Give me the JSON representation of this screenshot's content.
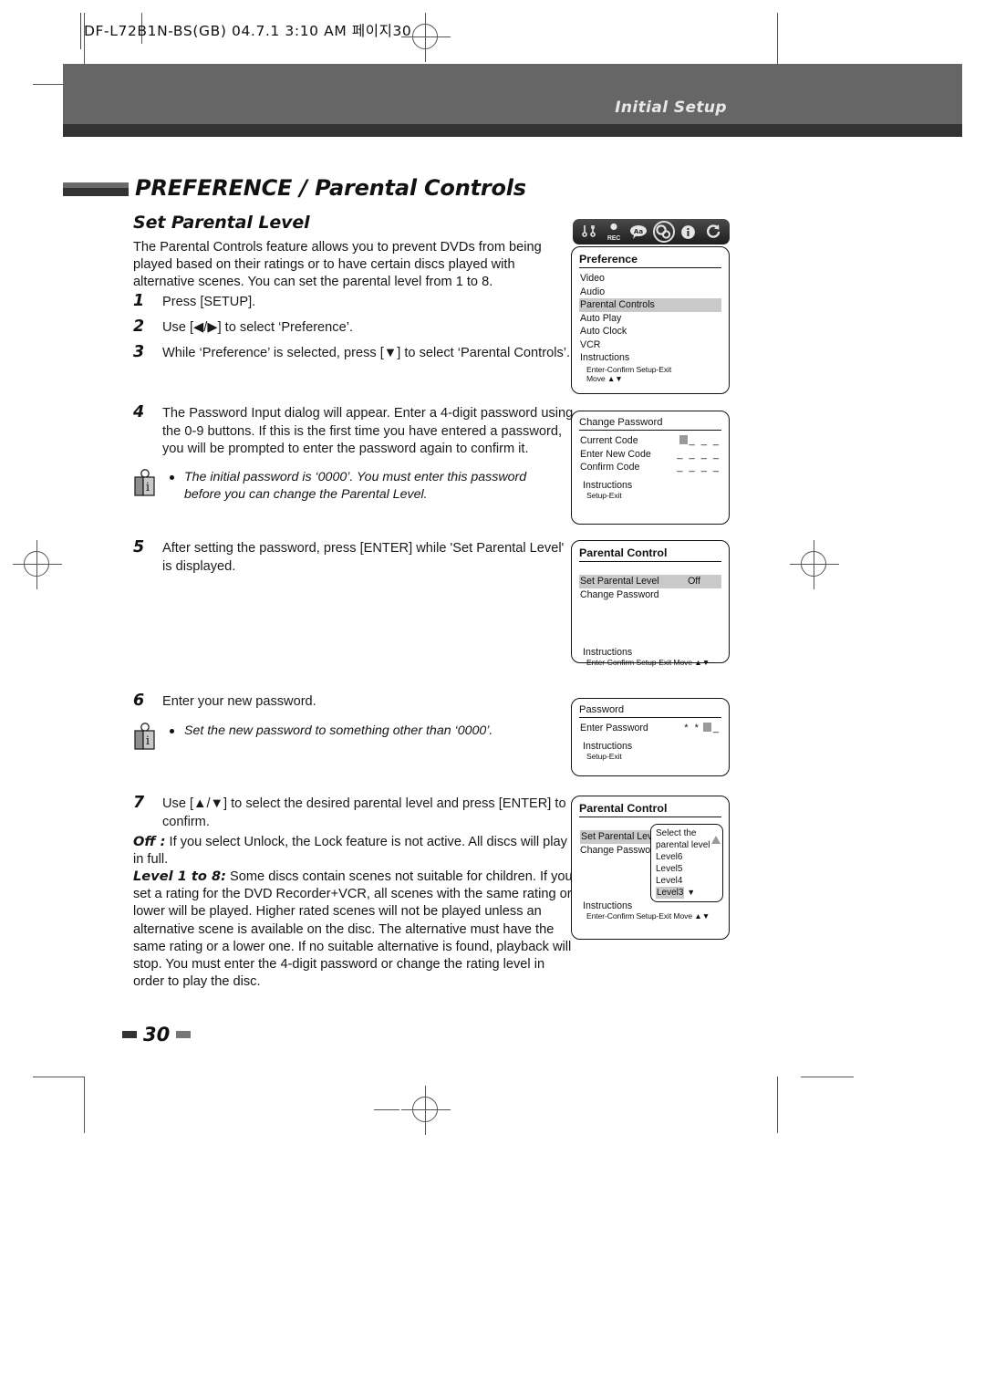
{
  "print_slug": "DF-L72B1N-BS(GB)   04.7.1 3:10 AM   페이지30",
  "banner": {
    "title": "Initial Setup"
  },
  "heading": {
    "section": "PREFERENCE / Parental Controls",
    "subsection": "Set Parental Level"
  },
  "intro": "The Parental Controls feature allows you to prevent DVDs from being played based on their ratings or to have certain discs played with alternative scenes. You can set the parental level from 1 to 8.",
  "steps": [
    {
      "num": "1",
      "text": "Press [SETUP]."
    },
    {
      "num": "2",
      "text": "Use [◀/▶] to select ‘Preference’."
    },
    {
      "num": "3",
      "text": "While ‘Preference’ is selected, press [▼] to select ‘Parental Controls’."
    },
    {
      "num": "4",
      "text": "The Password Input dialog will appear. Enter a 4-digit password using the 0-9 buttons. If this is the first time you have entered a password, you will be prompted to enter the password again to confirm it."
    },
    {
      "num": "5",
      "text": "After setting the password, press [ENTER] while 'Set Parental Level' is displayed."
    },
    {
      "num": "6",
      "text": "Enter your new password."
    },
    {
      "num": "7",
      "text": "Use [▲/▼] to select the desired parental level and press [ENTER] to confirm."
    }
  ],
  "notes": [
    "The initial password is ‘0000’. You must enter this password before you can change the Parental Level.",
    "Set the new password to something other than ‘0000’."
  ],
  "step7_details": [
    {
      "label": "Off :",
      "text": " If you select Unlock, the Lock feature is not active. All discs will play in full."
    },
    {
      "label": "Level 1 to 8:",
      "text": " Some discs contain scenes not suitable for children. If you set a rating for the DVD Recorder+VCR, all scenes with the same rating or lower will be played. Higher rated scenes will not be played unless an alternative scene is available on the disc. The alternative must have the same rating or a lower one. If no suitable alternative is found, playback will stop. You must enter the 4-digit password or change the rating level in order to play the disc."
    }
  ],
  "iconbar": [
    {
      "name": "tools-icon",
      "glyph": "⚒",
      "active": false
    },
    {
      "name": "rec-icon",
      "glyph": "REC",
      "active": false
    },
    {
      "name": "language-aa-icon",
      "glyph": "Aa",
      "active": false
    },
    {
      "name": "preference-gears-icon",
      "glyph": "⚙",
      "active": true
    },
    {
      "name": "info-icon",
      "glyph": "ⓘ",
      "active": false
    },
    {
      "name": "refresh-icon",
      "glyph": "↻",
      "active": false
    }
  ],
  "osd": {
    "preference": {
      "title": "Preference",
      "items": [
        "Video",
        "Audio",
        "Parental Controls",
        "Auto Play",
        "Auto Clock",
        "VCR"
      ],
      "selected": "Parental Controls",
      "instructions_label": "Instructions",
      "keys_line1": "Enter-Confirm   Setup-Exit",
      "keys_line2": "Move ▲▼"
    },
    "change_password": {
      "title": "Change Password",
      "rows": [
        {
          "label": "Current Code",
          "value": "_ _ _",
          "cursor": true
        },
        {
          "label": "Enter New Code",
          "value": "_ _ _ _",
          "cursor": false
        },
        {
          "label": "Confirm Code",
          "value": "_ _ _ _",
          "cursor": false
        }
      ],
      "instructions_label": "Instructions",
      "keys_line1": "Setup-Exit"
    },
    "parental_control_1": {
      "title": "Parental Control",
      "rows": [
        {
          "label": "Set Parental Level",
          "value": "Off",
          "selected": true
        },
        {
          "label": "Change Password",
          "value": "",
          "selected": false
        }
      ],
      "instructions_label": "Instructions",
      "keys_line1": "Enter-Confirm  Setup-Exit  Move ▲▼"
    },
    "password": {
      "title": "Password",
      "row_label": "Enter Password",
      "row_value": "* *",
      "row_tail": "_",
      "instructions_label": "Instructions",
      "keys_line1": "Setup-Exit"
    },
    "parental_control_2": {
      "title": "Parental Control",
      "rows": [
        {
          "label": "Set Parental Level",
          "selected": true
        },
        {
          "label": "Change Password",
          "selected": false
        }
      ],
      "dropdown": {
        "prompt_line1": "Select the",
        "prompt_line2": "parental level",
        "options": [
          "Level6",
          "Level5",
          "Level4"
        ],
        "selected_option": "Level3",
        "down_arrow": "▼"
      },
      "instructions_label": "Instructions",
      "keys_line1": "Enter-Confirm  Setup-Exit  Move ▲▼"
    }
  },
  "footer": {
    "page": "30"
  }
}
